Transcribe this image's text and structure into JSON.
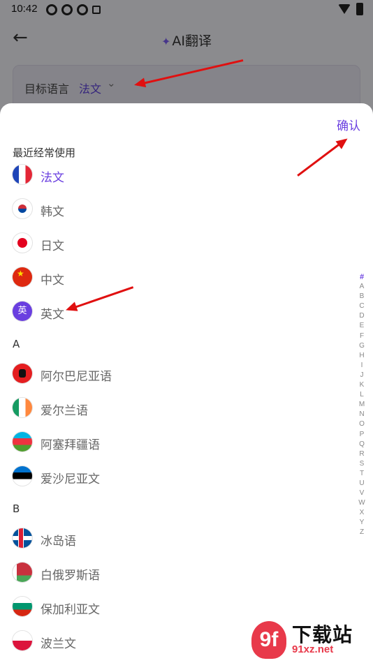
{
  "status_bar": {
    "time": "10:42"
  },
  "header": {
    "back_label": "←",
    "title": "AI翻译"
  },
  "target_language": {
    "label": "目标语言",
    "value": "法文",
    "chevron": "⌄"
  },
  "sheet": {
    "confirm_label": "确认",
    "sections": [
      {
        "title": "最近经常使用",
        "items": [
          {
            "name": "法文",
            "flag": "france-flag-icon",
            "selected": true
          },
          {
            "name": "韩文",
            "flag": "korea-flag-icon"
          },
          {
            "name": "日文",
            "flag": "japan-flag-icon"
          },
          {
            "name": "中文",
            "flag": "china-flag-icon"
          },
          {
            "name": "英文",
            "flag": "english-badge-icon",
            "badge": "英"
          }
        ]
      },
      {
        "title": "A",
        "items": [
          {
            "name": "阿尔巴尼亚语",
            "flag": "albania-flag-icon"
          },
          {
            "name": "爱尔兰语",
            "flag": "ireland-flag-icon"
          },
          {
            "name": "阿塞拜疆语",
            "flag": "azerbaijan-flag-icon"
          },
          {
            "name": "爱沙尼亚文",
            "flag": "estonia-flag-icon"
          }
        ]
      },
      {
        "title": "B",
        "items": [
          {
            "name": "冰岛语",
            "flag": "iceland-flag-icon"
          },
          {
            "name": "白俄罗斯语",
            "flag": "belarus-flag-icon"
          },
          {
            "name": "保加利亚文",
            "flag": "bulgaria-flag-icon"
          },
          {
            "name": "波兰文",
            "flag": "poland-flag-icon"
          }
        ]
      }
    ],
    "alphabet": [
      "#",
      "A",
      "B",
      "C",
      "D",
      "E",
      "F",
      "G",
      "H",
      "I",
      "J",
      "K",
      "L",
      "M",
      "N",
      "O",
      "P",
      "Q",
      "R",
      "S",
      "T",
      "U",
      "V",
      "W",
      "X",
      "Y",
      "Z"
    ]
  },
  "watermark": {
    "logo": "9f",
    "text": "下载站",
    "url": "91xz.net"
  },
  "colors": {
    "accent": "#6a3fe0",
    "annotation_arrow": "#e01010"
  }
}
